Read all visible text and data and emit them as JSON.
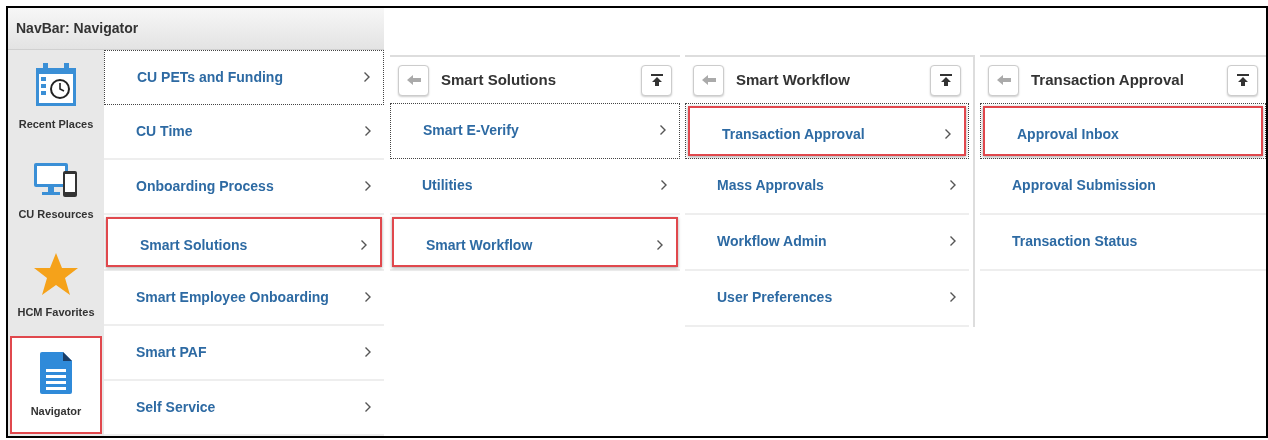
{
  "navigator": {
    "title": "NavBar: Navigator",
    "tiles": [
      {
        "label": "Recent Places",
        "kind": "calendar",
        "selected": false
      },
      {
        "label": "CU Resources",
        "kind": "devices",
        "selected": false
      },
      {
        "label": "HCM Favorites",
        "kind": "star",
        "selected": false
      },
      {
        "label": "Navigator",
        "kind": "document",
        "selected": true
      }
    ],
    "items": [
      {
        "label": "CU PETs and Funding",
        "selected": false,
        "focused": true,
        "expandable": true
      },
      {
        "label": "CU Time",
        "selected": false,
        "focused": false,
        "expandable": true
      },
      {
        "label": "Onboarding Process",
        "selected": false,
        "focused": false,
        "expandable": true
      },
      {
        "label": "Smart Solutions",
        "selected": true,
        "focused": false,
        "expandable": true
      },
      {
        "label": "Smart Employee Onboarding",
        "selected": false,
        "focused": false,
        "expandable": true
      },
      {
        "label": "Smart PAF",
        "selected": false,
        "focused": false,
        "expandable": true
      },
      {
        "label": "Self Service",
        "selected": false,
        "focused": false,
        "expandable": true
      }
    ]
  },
  "panels": [
    {
      "title": "Smart Solutions",
      "items": [
        {
          "label": "Smart E-Verify",
          "selected": false,
          "focused": true,
          "expandable": true
        },
        {
          "label": "Utilities",
          "selected": false,
          "focused": false,
          "expandable": true
        },
        {
          "label": "Smart Workflow",
          "selected": true,
          "focused": false,
          "expandable": true
        }
      ]
    },
    {
      "title": "Smart Workflow",
      "items": [
        {
          "label": "Transaction Approval",
          "selected": true,
          "focused": true,
          "expandable": true
        },
        {
          "label": "Mass Approvals",
          "selected": false,
          "focused": false,
          "expandable": true
        },
        {
          "label": "Workflow Admin",
          "selected": false,
          "focused": false,
          "expandable": true
        },
        {
          "label": "User Preferences",
          "selected": false,
          "focused": false,
          "expandable": true
        }
      ]
    },
    {
      "title": "Transaction Approval",
      "items": [
        {
          "label": "Approval Inbox",
          "selected": true,
          "focused": true,
          "expandable": false
        },
        {
          "label": "Approval Submission",
          "selected": false,
          "focused": false,
          "expandable": false
        },
        {
          "label": "Transaction Status",
          "selected": false,
          "focused": false,
          "expandable": false
        }
      ]
    }
  ]
}
